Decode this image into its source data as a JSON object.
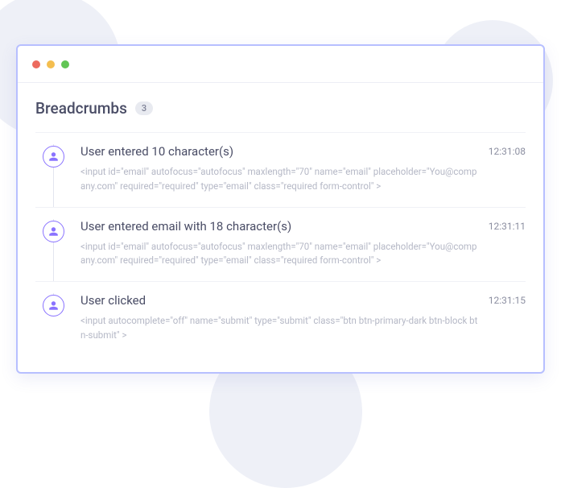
{
  "header": {
    "title": "Breadcrumbs",
    "badge": "3"
  },
  "events": [
    {
      "title": "User entered 10 character(s)",
      "detail": "<input id=\"email\" autofocus=\"autofocus\" maxlength=\"70\" name=\"email\" placeholder=\"You@company.com\" required=\"required\" type=\"email\" class=\"required form-control\" >",
      "timestamp": "12:31:08"
    },
    {
      "title": "User entered email with 18 character(s)",
      "detail": "<input id=\"email\" autofocus=\"autofocus\" maxlength=\"70\" name=\"email\" placeholder=\"You@company.com\" required=\"required\" type=\"email\" class=\"required form-control\" >",
      "timestamp": "12:31:11"
    },
    {
      "title": "User clicked",
      "detail": "<input autocomplete=\"off\" name=\"submit\" type=\"submit\" class=\"btn btn-primary-dark btn-block btn-submit\" >",
      "timestamp": "12:31:15"
    }
  ]
}
